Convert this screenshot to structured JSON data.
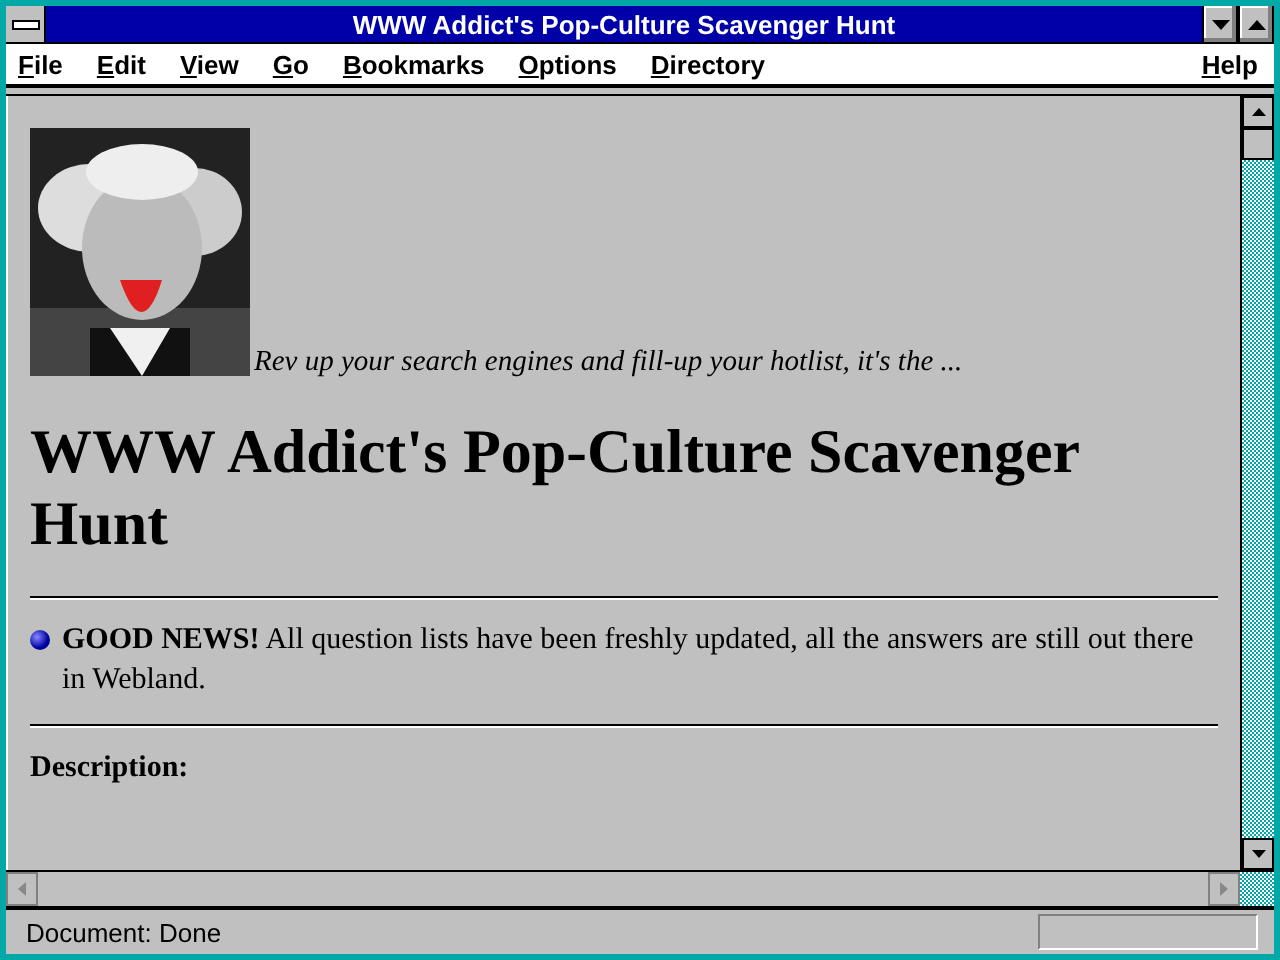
{
  "window": {
    "title": "WWW Addict's Pop-Culture Scavenger Hunt"
  },
  "menu": {
    "items": [
      "File",
      "Edit",
      "View",
      "Go",
      "Bookmarks",
      "Options",
      "Directory"
    ],
    "help": "Help"
  },
  "page": {
    "tagline": "Rev up your search engines and fill-up your hotlist, it's the ...",
    "heading": "WWW Addict's Pop-Culture Scavenger Hunt",
    "news": "**GOOD NEWS!** All question lists have been freshly updated, all the answers are still out there in Webland.",
    "section": "Description:"
  },
  "status_bar": {
    "text": "Document: Done",
    "progress": {
      "level": 0
    }
  }
}
